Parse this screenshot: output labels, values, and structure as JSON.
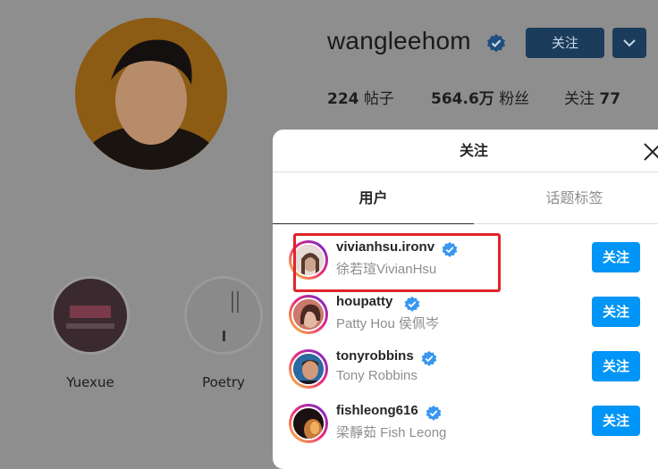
{
  "profile": {
    "username": "wangleehom",
    "follow_label": "关注",
    "dropdown_icon": "chevron-down-icon",
    "stats": {
      "posts_count": "224",
      "posts_label": "帖子",
      "followers_count": "564.6万",
      "followers_label": "粉丝",
      "following_label": "关注",
      "following_count": "77"
    },
    "highlights": [
      {
        "label": "Yuexue"
      },
      {
        "label": "Poetry"
      }
    ]
  },
  "modal": {
    "title": "关注",
    "tabs": [
      {
        "label": "用户",
        "active": true
      },
      {
        "label": "话题标签",
        "active": false
      }
    ],
    "users": [
      {
        "handle": "vivianhsu.ironv",
        "name": "徐若瑄VivianHsu",
        "verified": true,
        "button": "关注"
      },
      {
        "handle": "houpatty",
        "name": "Patty Hou 侯佩岑",
        "verified": true,
        "button": "关注"
      },
      {
        "handle": "tonyrobbins",
        "name": "Tony Robbins",
        "verified": true,
        "button": "关注"
      },
      {
        "handle": "fishleong616",
        "name": "梁靜茹 Fish Leong",
        "verified": true,
        "button": "关注"
      }
    ]
  },
  "colors": {
    "accent": "#0095f6",
    "highlight_box": "#e0242b",
    "verified": "#3897f0"
  }
}
